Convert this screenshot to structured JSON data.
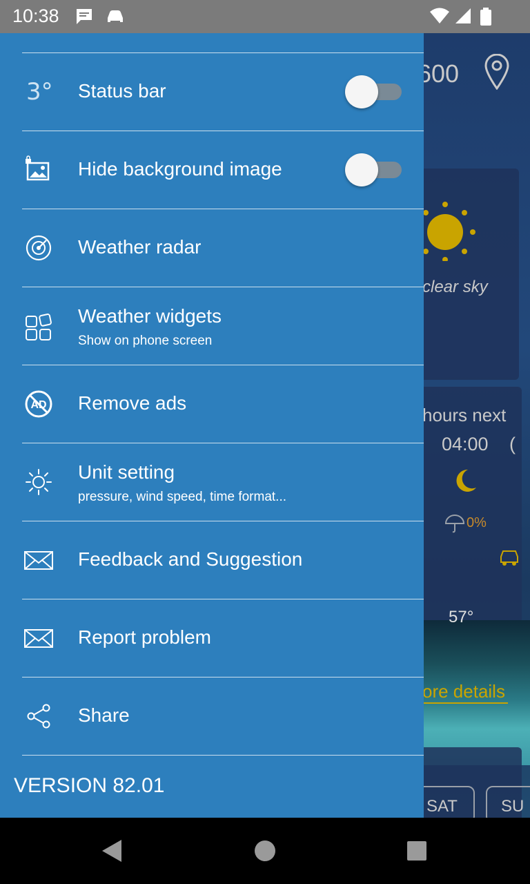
{
  "status_bar": {
    "time": "10:38",
    "icons": [
      "message-icon",
      "car-icon",
      "wifi-icon",
      "signal-icon",
      "battery-icon"
    ]
  },
  "background": {
    "header_value": "600",
    "condition": "clear sky",
    "forecast_title": "hours next",
    "forecast_time": "04:00",
    "precip": "0%",
    "temp": "57°",
    "more_details": "ore details",
    "day1": "SAT",
    "day2": "SU"
  },
  "drawer": {
    "items": [
      {
        "label": "Status bar",
        "icon": "temperature-3-icon",
        "toggle": false
      },
      {
        "label": "Hide background image",
        "icon": "image-lock-icon",
        "toggle": false
      },
      {
        "label": "Weather radar",
        "icon": "radar-icon"
      },
      {
        "label": "Weather widgets",
        "sub": "Show on phone screen",
        "icon": "widgets-icon"
      },
      {
        "label": "Remove ads",
        "icon": "no-ads-icon"
      },
      {
        "label": "Unit setting",
        "sub": "pressure, wind speed, time format...",
        "icon": "gear-sun-icon"
      },
      {
        "label": "Feedback and Suggestion",
        "icon": "envelope-icon"
      },
      {
        "label": "Report problem",
        "icon": "envelope-icon"
      },
      {
        "label": "Share",
        "icon": "share-icon"
      }
    ],
    "icon_texts": {
      "temp_icon": "3°",
      "ad_icon": "AD"
    },
    "version": "VERSION 82.01"
  },
  "colors": {
    "drawer_bg": "#2d7fbd",
    "status_bar": "#7b7b7b",
    "sun": "#c9a400"
  }
}
